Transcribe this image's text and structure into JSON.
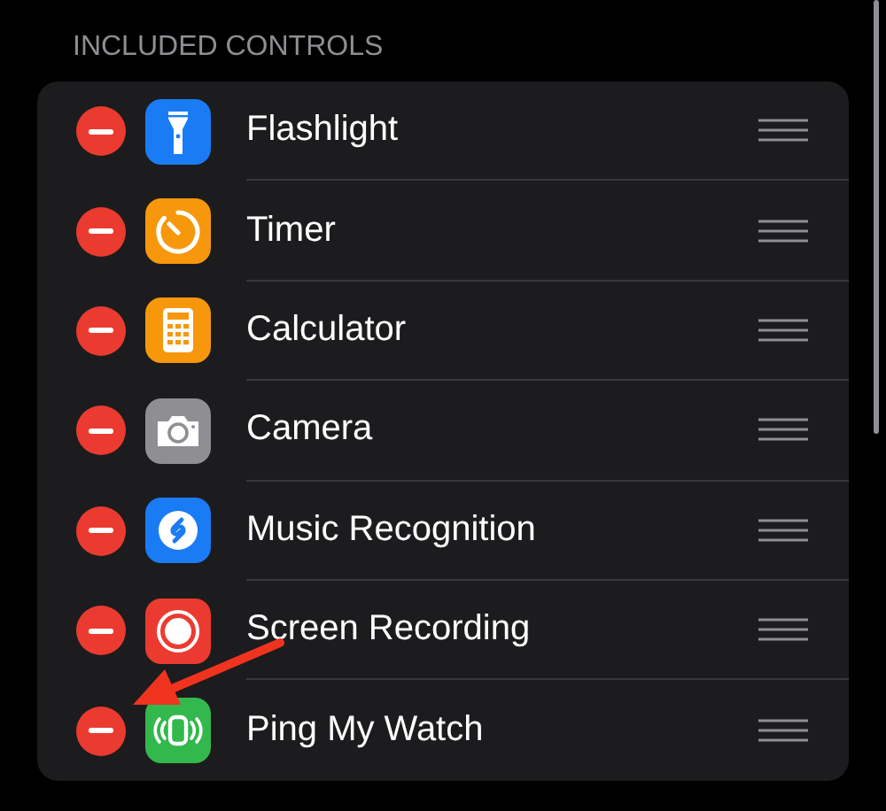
{
  "section_header": "INCLUDED CONTROLS",
  "controls": [
    {
      "label": "Flashlight",
      "kind": "flashlight",
      "color": "#1a7cf5"
    },
    {
      "label": "Timer",
      "kind": "timer",
      "color": "#f7970b"
    },
    {
      "label": "Calculator",
      "kind": "calculator",
      "color": "#f7970b"
    },
    {
      "label": "Camera",
      "kind": "camera",
      "color": "#8e8e93"
    },
    {
      "label": "Music Recognition",
      "kind": "swirl",
      "color": "#1a7cf5"
    },
    {
      "label": "Screen Recording",
      "kind": "record",
      "color": "#eb3b30"
    },
    {
      "label": "Ping My Watch",
      "kind": "watch",
      "color": "#33b84d"
    }
  ]
}
